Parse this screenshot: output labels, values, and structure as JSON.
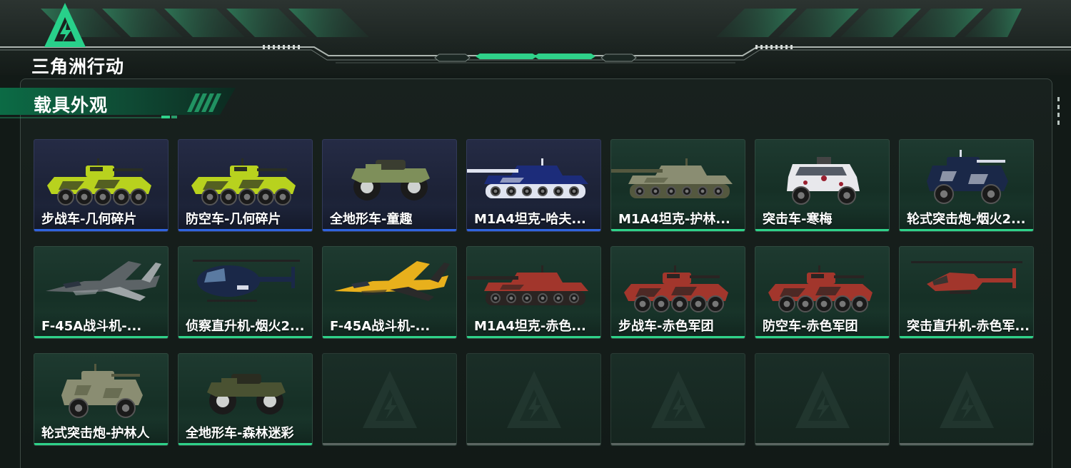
{
  "game": {
    "logo_text": "三角洲行动"
  },
  "section": {
    "title": "载具外观"
  },
  "colors": {
    "rarity_blue": "#2f64e0",
    "rarity_green": "#2fd28a",
    "empty_gray": "#5b6662",
    "accent": "#2fd28a"
  },
  "items": [
    {
      "name": "步战车-几何碎片",
      "rarity": "blue",
      "icon": "ifv-icon",
      "palette": [
        "#b8d21e",
        "#2a2f22"
      ]
    },
    {
      "name": "防空车-几何碎片",
      "rarity": "blue",
      "icon": "ifv-icon",
      "palette": [
        "#b8d21e",
        "#2a2f22"
      ]
    },
    {
      "name": "全地形车-童趣",
      "rarity": "blue",
      "icon": "atv-icon",
      "palette": [
        "#7e8f5a",
        "#3a3d30"
      ]
    },
    {
      "name": "M1A4坦克-哈夫...",
      "rarity": "blue",
      "icon": "tank-icon",
      "palette": [
        "#1c2c7a",
        "#e0e4f0"
      ]
    },
    {
      "name": "M1A4坦克-护林...",
      "rarity": "green",
      "icon": "tank-icon",
      "palette": [
        "#8a8d72",
        "#54583f"
      ]
    },
    {
      "name": "突击车-寒梅",
      "rarity": "green",
      "icon": "armored-car-icon",
      "palette": [
        "#e8e8ec",
        "#9a2030"
      ]
    },
    {
      "name": "轮式突击炮-烟火2...",
      "rarity": "green",
      "icon": "wheeled-gun-icon",
      "palette": [
        "#1a2848",
        "#d8dce8"
      ]
    },
    {
      "name": "F-45A战斗机-...",
      "rarity": "green",
      "icon": "jet-icon",
      "palette": [
        "#5c6366",
        "#9ea4a6"
      ]
    },
    {
      "name": "侦察直升机-烟火2...",
      "rarity": "green",
      "icon": "helicopter-icon",
      "palette": [
        "#1a2848",
        "#d8dce8"
      ]
    },
    {
      "name": "F-45A战斗机-...",
      "rarity": "green",
      "icon": "jet-icon",
      "palette": [
        "#e8b01c",
        "#2a2a2a"
      ]
    },
    {
      "name": "M1A4坦克-赤色...",
      "rarity": "green",
      "icon": "tank-icon",
      "palette": [
        "#a2362c",
        "#2a2422"
      ]
    },
    {
      "name": "步战车-赤色军团",
      "rarity": "green",
      "icon": "ifv-icon",
      "palette": [
        "#a2362c",
        "#2a2422"
      ]
    },
    {
      "name": "防空车-赤色军团",
      "rarity": "green",
      "icon": "ifv-icon",
      "palette": [
        "#a2362c",
        "#2a2422"
      ]
    },
    {
      "name": "突击直升机-赤色军...",
      "rarity": "green",
      "icon": "attack-helicopter-icon",
      "palette": [
        "#a2362c",
        "#2a2422"
      ]
    },
    {
      "name": "轮式突击炮-护林人",
      "rarity": "green",
      "icon": "wheeled-gun-icon",
      "palette": [
        "#8a8d72",
        "#54583f"
      ]
    },
    {
      "name": "全地形车-森林迷彩",
      "rarity": "green",
      "icon": "atv-icon",
      "palette": [
        "#4a5232",
        "#2a2c20"
      ]
    },
    {
      "name": "",
      "rarity": "empty",
      "icon": "empty-slot-icon"
    },
    {
      "name": "",
      "rarity": "empty",
      "icon": "empty-slot-icon"
    },
    {
      "name": "",
      "rarity": "empty",
      "icon": "empty-slot-icon"
    },
    {
      "name": "",
      "rarity": "empty",
      "icon": "empty-slot-icon"
    },
    {
      "name": "",
      "rarity": "empty",
      "icon": "empty-slot-icon"
    }
  ]
}
